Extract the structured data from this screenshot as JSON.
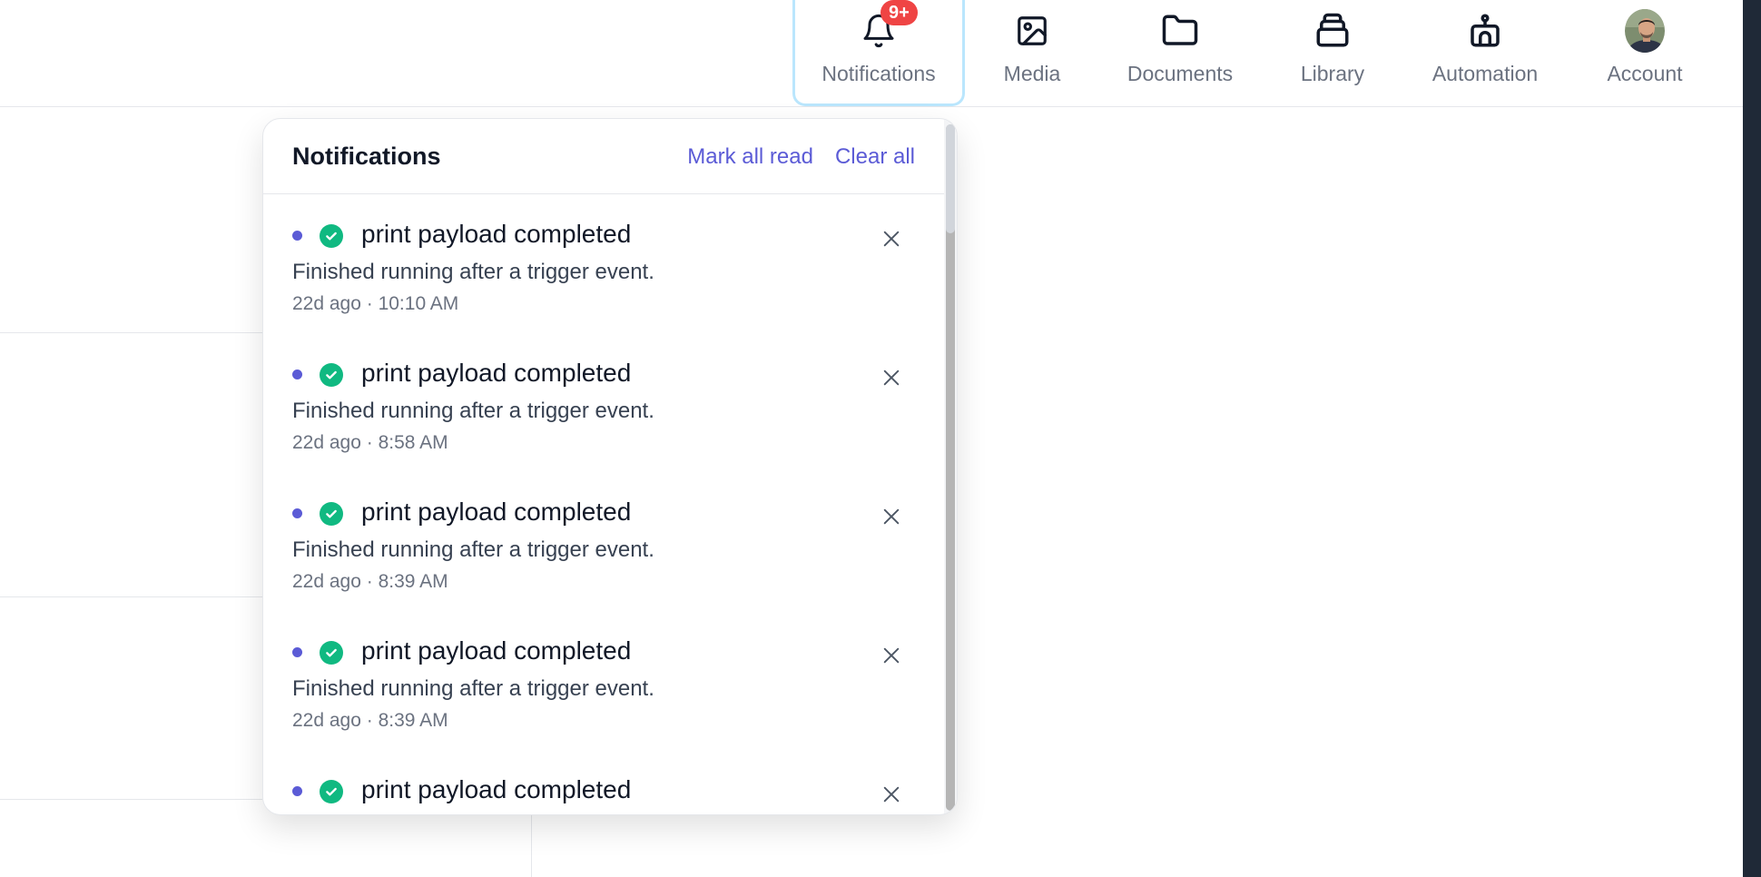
{
  "nav": {
    "items": [
      {
        "label": "Notifications",
        "icon": "bell-icon",
        "badge": "9+",
        "active": true
      },
      {
        "label": "Media",
        "icon": "image-icon"
      },
      {
        "label": "Documents",
        "icon": "folder-icon"
      },
      {
        "label": "Library",
        "icon": "stack-icon"
      },
      {
        "label": "Automation",
        "icon": "robot-icon"
      },
      {
        "label": "Account",
        "icon": "avatar"
      }
    ]
  },
  "notifications": {
    "title": "Notifications",
    "mark_all_read": "Mark all read",
    "clear_all": "Clear all",
    "items": [
      {
        "title": "print payload completed",
        "body": "Finished running after a trigger event.",
        "time": "22d ago · 10:10 AM",
        "status": "success",
        "unread": true
      },
      {
        "title": "print payload completed",
        "body": "Finished running after a trigger event.",
        "time": "22d ago · 8:58 AM",
        "status": "success",
        "unread": true
      },
      {
        "title": "print payload completed",
        "body": "Finished running after a trigger event.",
        "time": "22d ago · 8:39 AM",
        "status": "success",
        "unread": true
      },
      {
        "title": "print payload completed",
        "body": "Finished running after a trigger event.",
        "time": "22d ago · 8:39 AM",
        "status": "success",
        "unread": true
      },
      {
        "title": "print payload completed",
        "body": "",
        "time": "",
        "status": "success",
        "unread": true
      }
    ]
  },
  "colors": {
    "accent": "#5b5bd6",
    "success": "#10b981",
    "badge": "#ef4444",
    "active_border": "#bae6fd"
  }
}
